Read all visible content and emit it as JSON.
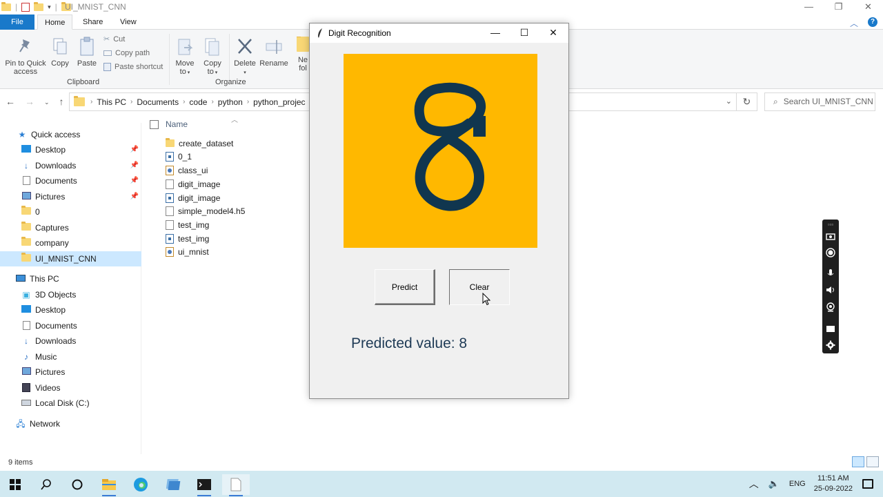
{
  "explorer": {
    "title": "UI_MNIST_CNN",
    "tabs": {
      "file": "File",
      "home": "Home",
      "share": "Share",
      "view": "View"
    },
    "ribbon": {
      "pin_label_1": "Pin to Quick",
      "pin_label_2": "access",
      "copy": "Copy",
      "paste": "Paste",
      "cut": "Cut",
      "copy_path": "Copy path",
      "paste_shortcut": "Paste shortcut",
      "clipboard_group": "Clipboard",
      "move_to_1": "Move",
      "move_to_2": "to",
      "copy_to_1": "Copy",
      "copy_to_2": "to",
      "delete": "Delete",
      "rename": "Rename",
      "new_folder_1": "Ne",
      "new_folder_2": "fol",
      "organize_group": "Organize"
    },
    "address": {
      "crumbs": [
        "This PC",
        "Documents",
        "code",
        "python",
        "python_projec"
      ],
      "search_placeholder": "Search UI_MNIST_CNN"
    },
    "nav": {
      "quick_access": "Quick access",
      "quick_items": [
        "Desktop",
        "Downloads",
        "Documents",
        "Pictures",
        "0",
        "Captures",
        "company",
        "UI_MNIST_CNN"
      ],
      "this_pc": "This PC",
      "pc_items": [
        "3D Objects",
        "Desktop",
        "Documents",
        "Downloads",
        "Music",
        "Pictures",
        "Videos",
        "Local Disk (C:)"
      ],
      "network": "Network"
    },
    "list": {
      "column_name": "Name",
      "files": [
        {
          "name": "create_dataset",
          "icon": "folder-icon"
        },
        {
          "name": "0_1",
          "icon": "python-file-icon"
        },
        {
          "name": "class_ui",
          "icon": "python-window-file-icon"
        },
        {
          "name": "digit_image",
          "icon": "document-icon"
        },
        {
          "name": "digit_image",
          "icon": "python-file-icon"
        },
        {
          "name": "simple_model4.h5",
          "icon": "document-icon"
        },
        {
          "name": "test_img",
          "icon": "document-icon"
        },
        {
          "name": "test_img",
          "icon": "python-file-icon"
        },
        {
          "name": "ui_mnist",
          "icon": "python-window-file-icon"
        }
      ]
    },
    "status": {
      "count": "9 items"
    }
  },
  "app": {
    "title": "Digit Recognition",
    "predict_label": "Predict",
    "clear_label": "Clear",
    "result_text": "Predicted value: 8",
    "canvas_color": "#ffb800",
    "ink_color": "#10364f"
  },
  "taskbar": {
    "language": "ENG",
    "time": "11:51 AM",
    "date": "25-09-2022"
  }
}
